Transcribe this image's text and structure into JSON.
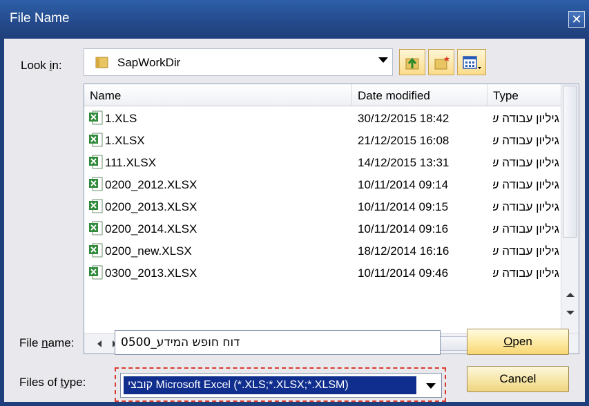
{
  "window": {
    "title": "File Name"
  },
  "lookin": {
    "label_pre": "Look ",
    "label_u": "i",
    "label_post": "n:",
    "value": "SapWorkDir"
  },
  "columns": {
    "name": "Name",
    "date": "Date modified",
    "type": "Type"
  },
  "files": [
    {
      "name": "1.XLS",
      "date": "30/12/2015 18:42",
      "type": "גיליון עבודה של"
    },
    {
      "name": "1.XLSX",
      "date": "21/12/2015 16:08",
      "type": "גיליון עבודה של"
    },
    {
      "name": "111.XLSX",
      "date": "14/12/2015 13:31",
      "type": "גיליון עבודה של"
    },
    {
      "name": "0200_2012.XLSX",
      "date": "10/11/2014 09:14",
      "type": "גיליון עבודה של"
    },
    {
      "name": "0200_2013.XLSX",
      "date": "10/11/2014 09:15",
      "type": "גיליון עבודה של"
    },
    {
      "name": "0200_2014.XLSX",
      "date": "10/11/2014 09:16",
      "type": "גיליון עבודה של"
    },
    {
      "name": "0200_new.XLSX",
      "date": "18/12/2014 16:16",
      "type": "גיליון עבודה של"
    },
    {
      "name": "0300_2013.XLSX",
      "date": "10/11/2014 09:46",
      "type": "גיליון עבודה של"
    }
  ],
  "filename": {
    "label_pre": "File ",
    "label_u": "n",
    "label_post": "ame:",
    "value": "דוח חופש המידע_0500"
  },
  "filetype": {
    "label_pre": "Files of ",
    "label_u": "t",
    "label_post": "ype:",
    "value": "קובצי Microsoft Excel (*.XLS;*.XLSX;*.XLSM)"
  },
  "buttons": {
    "open_u": "O",
    "open_rest": "pen",
    "cancel": "Cancel"
  },
  "colors": {
    "title_bar": "#24498a",
    "selection": "#102e8e",
    "button": "#fde9a2"
  }
}
